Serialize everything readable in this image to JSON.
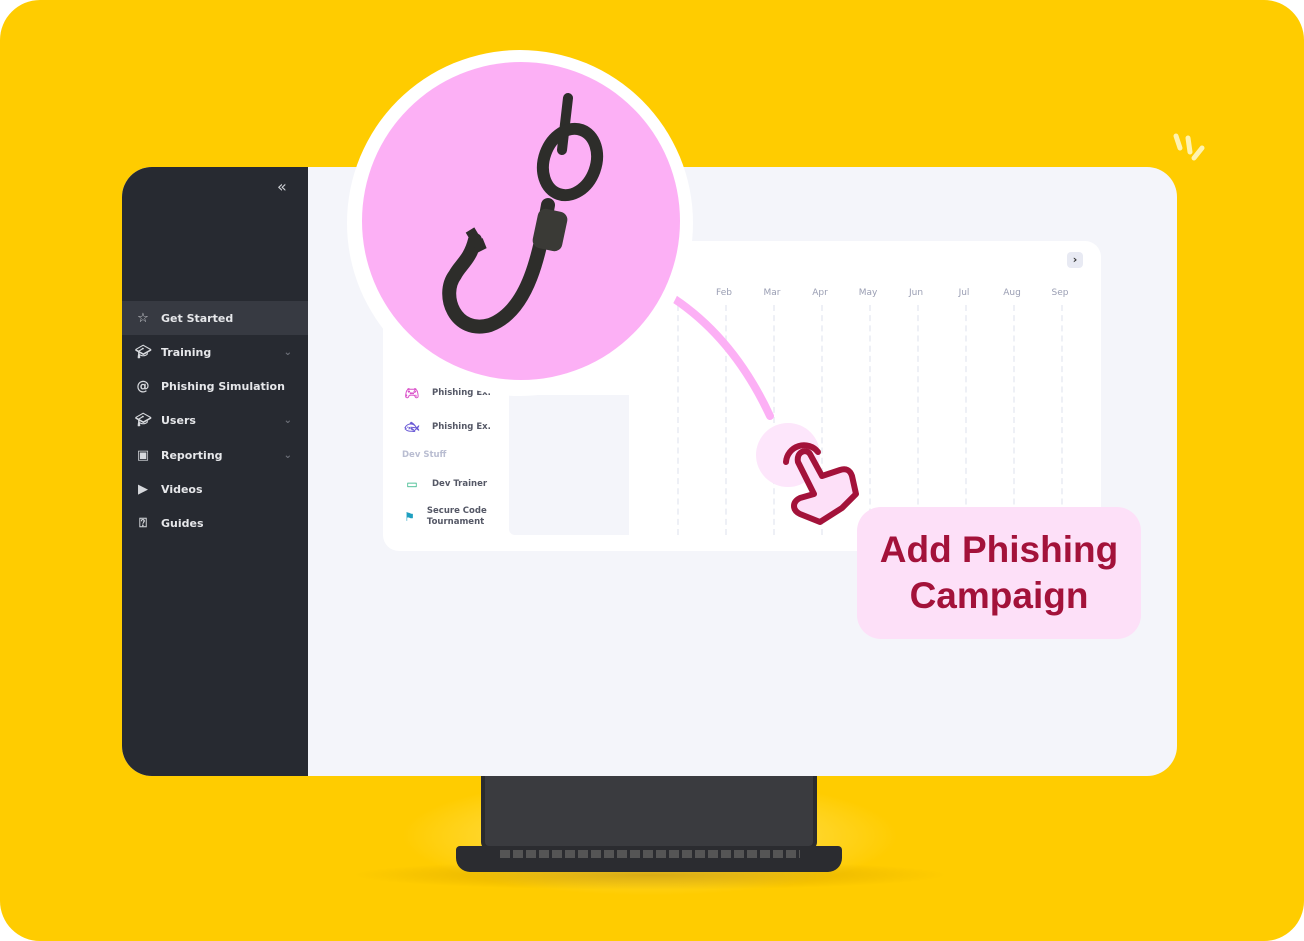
{
  "sidebar": {
    "collapse_icon": "chevrons-left-icon",
    "items": [
      {
        "label": "Get Started",
        "icon": "star-icon",
        "active": true
      },
      {
        "label": "Training",
        "icon": "graduation-cap-icon",
        "expandable": true
      },
      {
        "label": "Phishing Simulation",
        "icon": "at-sign-icon"
      },
      {
        "label": "Users",
        "icon": "graduation-cap-icon",
        "expandable": true
      },
      {
        "label": "Reporting",
        "icon": "dashboard-icon",
        "expandable": true
      },
      {
        "label": "Videos",
        "icon": "video-library-icon"
      },
      {
        "label": "Guides",
        "icon": "help-box-icon"
      }
    ]
  },
  "card": {
    "list": [
      {
        "label": "Phishing Ex.",
        "icon": "gamepad-icon",
        "color": "#d94fc8"
      },
      {
        "label": "Phishing Ex.",
        "icon": "fish-icon",
        "color": "#6b5bd6"
      }
    ],
    "section": "Dev Stuff",
    "dev_list": [
      {
        "label": "Dev Trainer",
        "icon": "monitor-code-icon",
        "color": "#22b07d"
      },
      {
        "label": "Secure Code Tournament",
        "icon": "flag-code-icon",
        "color": "#1e9fc0"
      }
    ],
    "months": [
      "Feb",
      "Mar",
      "Apr",
      "May",
      "Jun",
      "Jul",
      "Aug",
      "Sep"
    ]
  },
  "callout": {
    "line1": "Add Phishing",
    "line2": "Campaign"
  },
  "colors": {
    "background": "#ffcc00",
    "sidebar": "#272a31",
    "accent_pink": "#fcb0f5",
    "callout_text": "#a3123a",
    "callout_bg": "#fde0f8"
  }
}
